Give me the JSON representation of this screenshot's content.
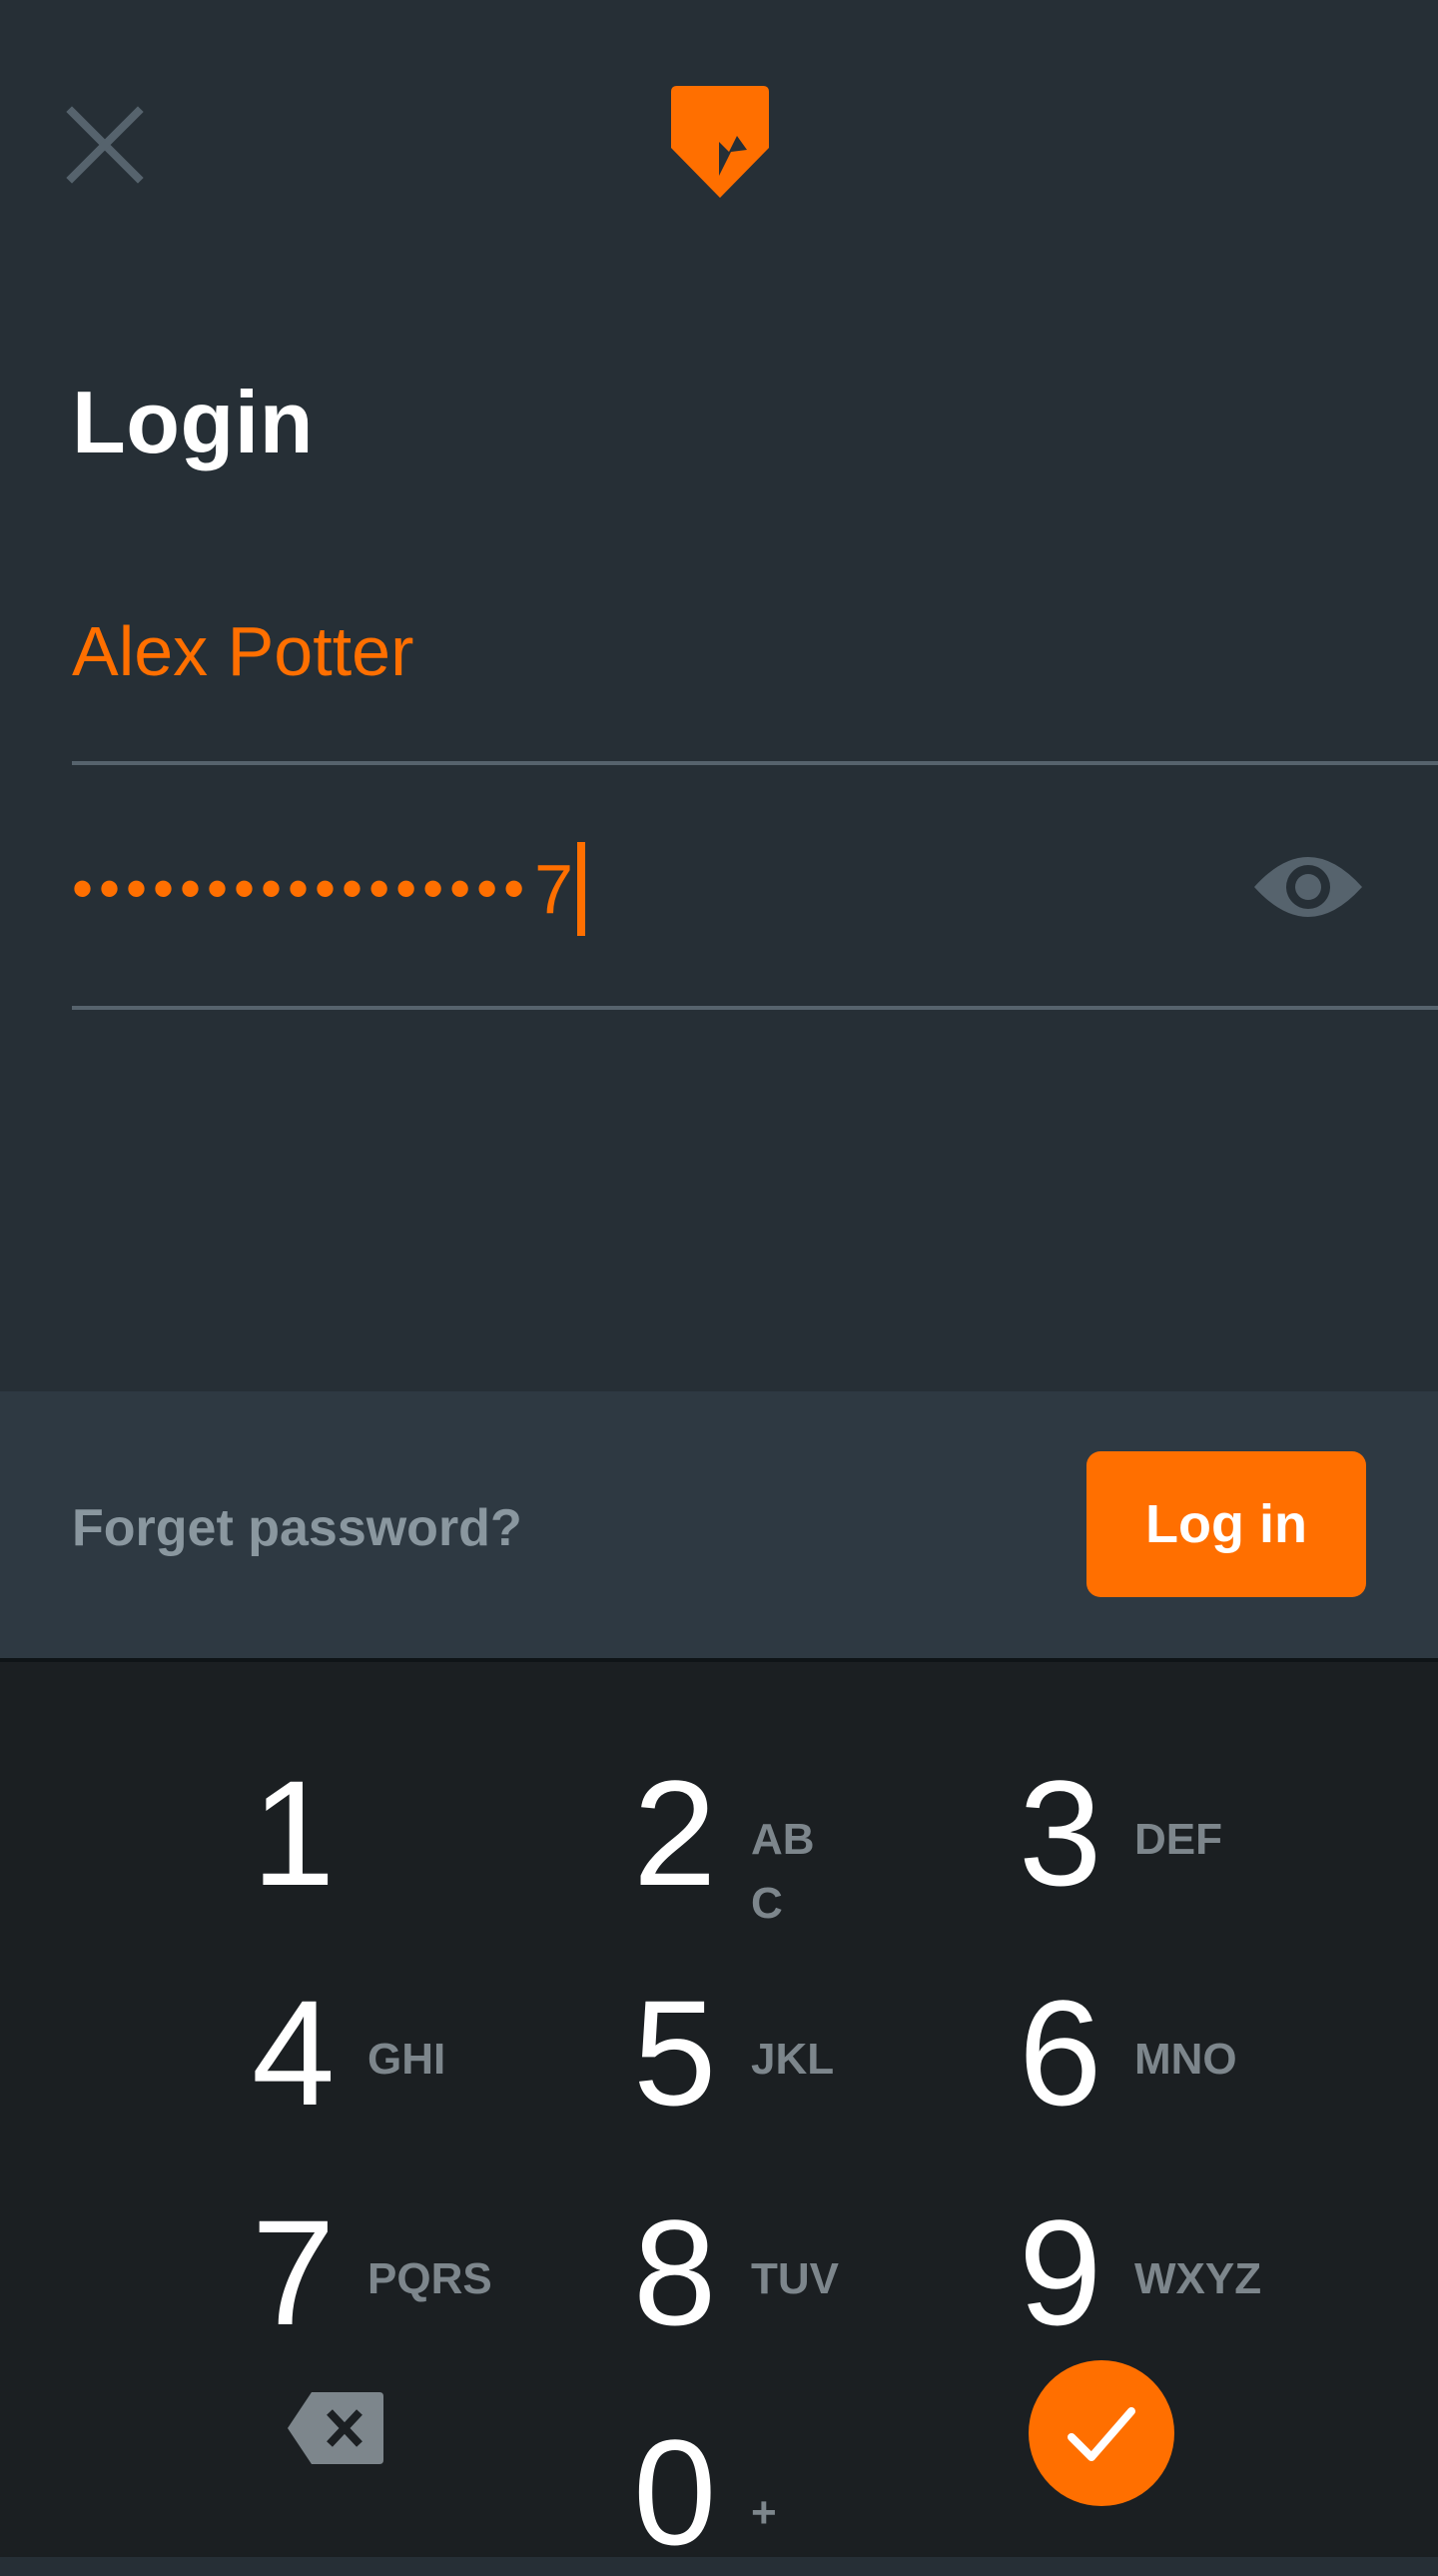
{
  "header": {
    "close_icon": "close-icon",
    "logo_icon": "app-logo-icon",
    "title": "Login"
  },
  "form": {
    "username_value": "Alex Potter",
    "password_masked": "•••••••••••••••••",
    "password_last_char": "7",
    "visibility_icon": "eye-icon"
  },
  "actions": {
    "forgot_label": "Forget password?",
    "login_label": "Log in"
  },
  "keypad": {
    "keys": [
      {
        "num": "1",
        "letters": ""
      },
      {
        "num": "2",
        "letters": "AB\nC"
      },
      {
        "num": "3",
        "letters": "DEF"
      },
      {
        "num": "4",
        "letters": "GHI"
      },
      {
        "num": "5",
        "letters": "JKL"
      },
      {
        "num": "6",
        "letters": "MNO"
      },
      {
        "num": "7",
        "letters": "PQRS"
      },
      {
        "num": "8",
        "letters": "TUV"
      },
      {
        "num": "9",
        "letters": "WXYZ"
      },
      {
        "num": "0",
        "letters": "+"
      }
    ],
    "backspace_icon": "backspace-icon",
    "confirm_icon": "check-icon"
  },
  "colors": {
    "accent": "#ff6f00",
    "background": "#262f36",
    "action_bar": "#2e3942",
    "keypad": "#1b1f22"
  }
}
